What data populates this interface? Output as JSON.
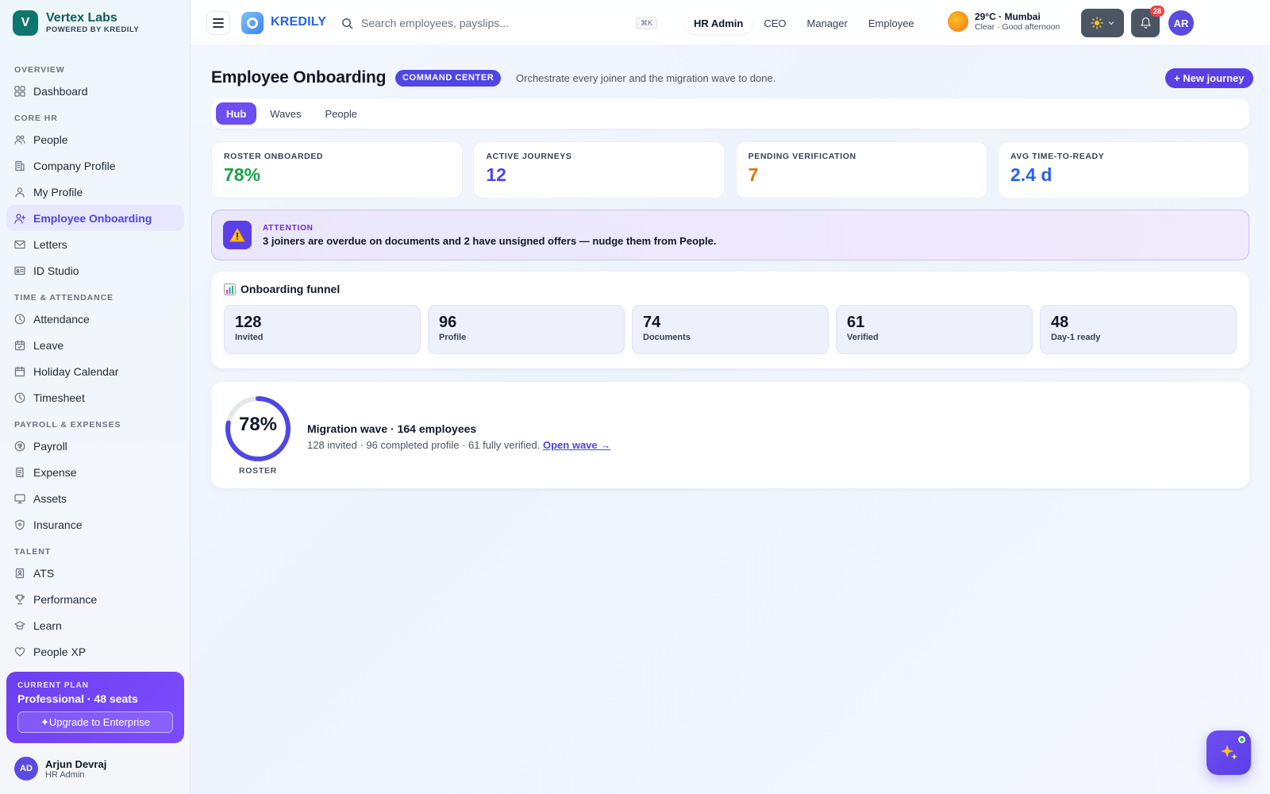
{
  "brand": {
    "initial": "V",
    "name": "Vertex Labs",
    "tagline": "POWERED BY KREDILY"
  },
  "sidebar": {
    "sections": [
      {
        "title": "OVERVIEW",
        "items": [
          {
            "label": "Dashboard",
            "icon": "grid-icon"
          }
        ]
      },
      {
        "title": "CORE HR",
        "items": [
          {
            "label": "People",
            "icon": "users-icon"
          },
          {
            "label": "Company Profile",
            "icon": "building-icon"
          },
          {
            "label": "My Profile",
            "icon": "user-icon"
          },
          {
            "label": "Employee Onboarding",
            "icon": "user-plus-icon",
            "active": true
          },
          {
            "label": "Letters",
            "icon": "mail-icon"
          },
          {
            "label": "ID Studio",
            "icon": "id-card-icon"
          }
        ]
      },
      {
        "title": "TIME & ATTENDANCE",
        "items": [
          {
            "label": "Attendance",
            "icon": "clock-icon"
          },
          {
            "label": "Leave",
            "icon": "calendar-check-icon"
          },
          {
            "label": "Holiday Calendar",
            "icon": "calendar-icon"
          },
          {
            "label": "Timesheet",
            "icon": "clock-icon"
          }
        ]
      },
      {
        "title": "PAYROLL & EXPENSES",
        "items": [
          {
            "label": "Payroll",
            "icon": "currency-icon"
          },
          {
            "label": "Expense",
            "icon": "receipt-icon"
          },
          {
            "label": "Assets",
            "icon": "monitor-icon"
          },
          {
            "label": "Insurance",
            "icon": "shield-icon"
          }
        ]
      },
      {
        "title": "TALENT",
        "items": [
          {
            "label": "ATS",
            "icon": "badge-icon"
          },
          {
            "label": "Performance",
            "icon": "trophy-icon"
          },
          {
            "label": "Learn",
            "icon": "graduation-icon"
          },
          {
            "label": "People XP",
            "icon": "heart-icon"
          }
        ]
      }
    ]
  },
  "plan": {
    "label": "CURRENT PLAN",
    "name": "Professional · 48 seats",
    "upgrade_label": "✦Upgrade to Enterprise"
  },
  "user": {
    "initials": "AD",
    "name": "Arjun Devraj",
    "role": "HR Admin"
  },
  "topbar": {
    "app_name": "KREDILY",
    "search_placeholder": "Search employees, payslips...",
    "search_shortcut": "⌘K",
    "roles": [
      {
        "label": "HR Admin",
        "active": true
      },
      {
        "label": "CEO"
      },
      {
        "label": "Manager"
      },
      {
        "label": "Employee"
      }
    ],
    "weather": {
      "temp": "29°C · Mumbai",
      "sub": "Clear · Good afternoon"
    },
    "notifications": "28",
    "avatar": "AR"
  },
  "page": {
    "title": "Employee Onboarding",
    "badge": "COMMAND CENTER",
    "subtitle": "Orchestrate every joiner and the migration wave to done.",
    "new_journey_label": "+ New journey",
    "tabs": [
      {
        "label": "Hub",
        "active": true
      },
      {
        "label": "Waves"
      },
      {
        "label": "People"
      }
    ]
  },
  "kpis": [
    {
      "label": "ROSTER ONBOARDED",
      "value": "78%",
      "color": "#16a34a"
    },
    {
      "label": "ACTIVE JOURNEYS",
      "value": "12",
      "color": "#4f46e5"
    },
    {
      "label": "PENDING VERIFICATION",
      "value": "7",
      "color": "#d97706"
    },
    {
      "label": "AVG TIME-TO-READY",
      "value": "2.4 d",
      "color": "#2563eb"
    }
  ],
  "attention": {
    "label": "ATTENTION",
    "count_overdue": "3 joiners",
    "text_1": " are overdue on documents and ",
    "count_unsigned": "2",
    "text_2": " have unsigned offers — nudge them from People."
  },
  "funnel": {
    "title": "Onboarding funnel",
    "steps": [
      {
        "value": "128",
        "label": "Invited"
      },
      {
        "value": "96",
        "label": "Profile"
      },
      {
        "value": "74",
        "label": "Documents"
      },
      {
        "value": "61",
        "label": "Verified"
      },
      {
        "value": "48",
        "label": "Day-1 ready"
      }
    ]
  },
  "wave": {
    "percent": 78,
    "percent_label": "78%",
    "ring_label": "ROSTER",
    "title": "Migration wave · 164 employees",
    "summary": "128 invited · 96 completed profile · 61 fully verified. ",
    "link_label": "Open wave →"
  },
  "colors": {
    "accent": "#5b3fe6",
    "brand": "#0f766e",
    "link": "#2563eb"
  }
}
